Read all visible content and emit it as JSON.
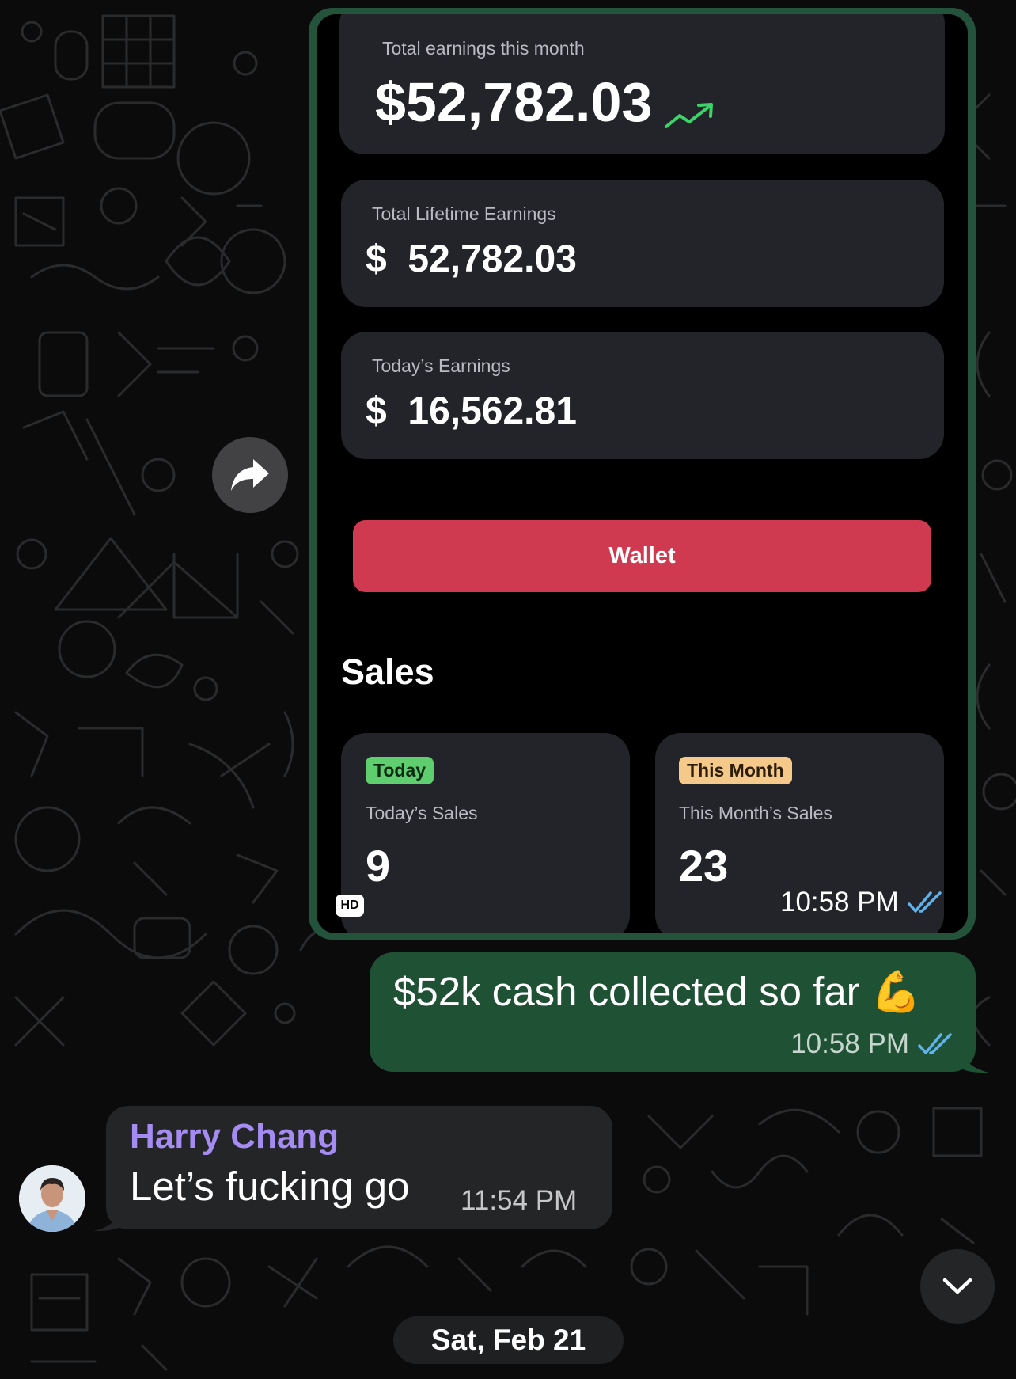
{
  "image_message": {
    "earnings_month_label": "Total earnings this month",
    "earnings_month_value": "$52,782.03",
    "lifetime_label": "Total Lifetime Earnings",
    "lifetime_value": "$  52,782.03",
    "today_label": "Today’s Earnings",
    "today_value": "$  16,562.81",
    "wallet_button": "Wallet",
    "sales_heading": "Sales",
    "today_sales": {
      "badge": "Today",
      "label": "Today’s Sales",
      "value": "9"
    },
    "month_sales": {
      "badge": "This Month",
      "label": "This Month’s Sales",
      "value": "23"
    },
    "hd_badge": "HD",
    "time": "10:58 PM"
  },
  "outgoing_message": {
    "text": "$52k cash collected so far 💪",
    "time": "10:58 PM"
  },
  "incoming_message": {
    "sender": "Harry Chang",
    "text": "Let’s fucking go",
    "time": "11:54 PM"
  },
  "date_separator": "Sat, Feb 21",
  "colors": {
    "outgoing_bubble": "#1f5135",
    "incoming_bubble": "#242527",
    "sender_name": "#a48cf2",
    "wallet_button": "#d03a51",
    "read_ticks": "#5fb2ea",
    "today_badge": "#5fce6f",
    "month_badge": "#f5c98a"
  },
  "icons": [
    "forward-icon",
    "trend-up-icon",
    "double-check-icon",
    "chevron-down-icon"
  ]
}
